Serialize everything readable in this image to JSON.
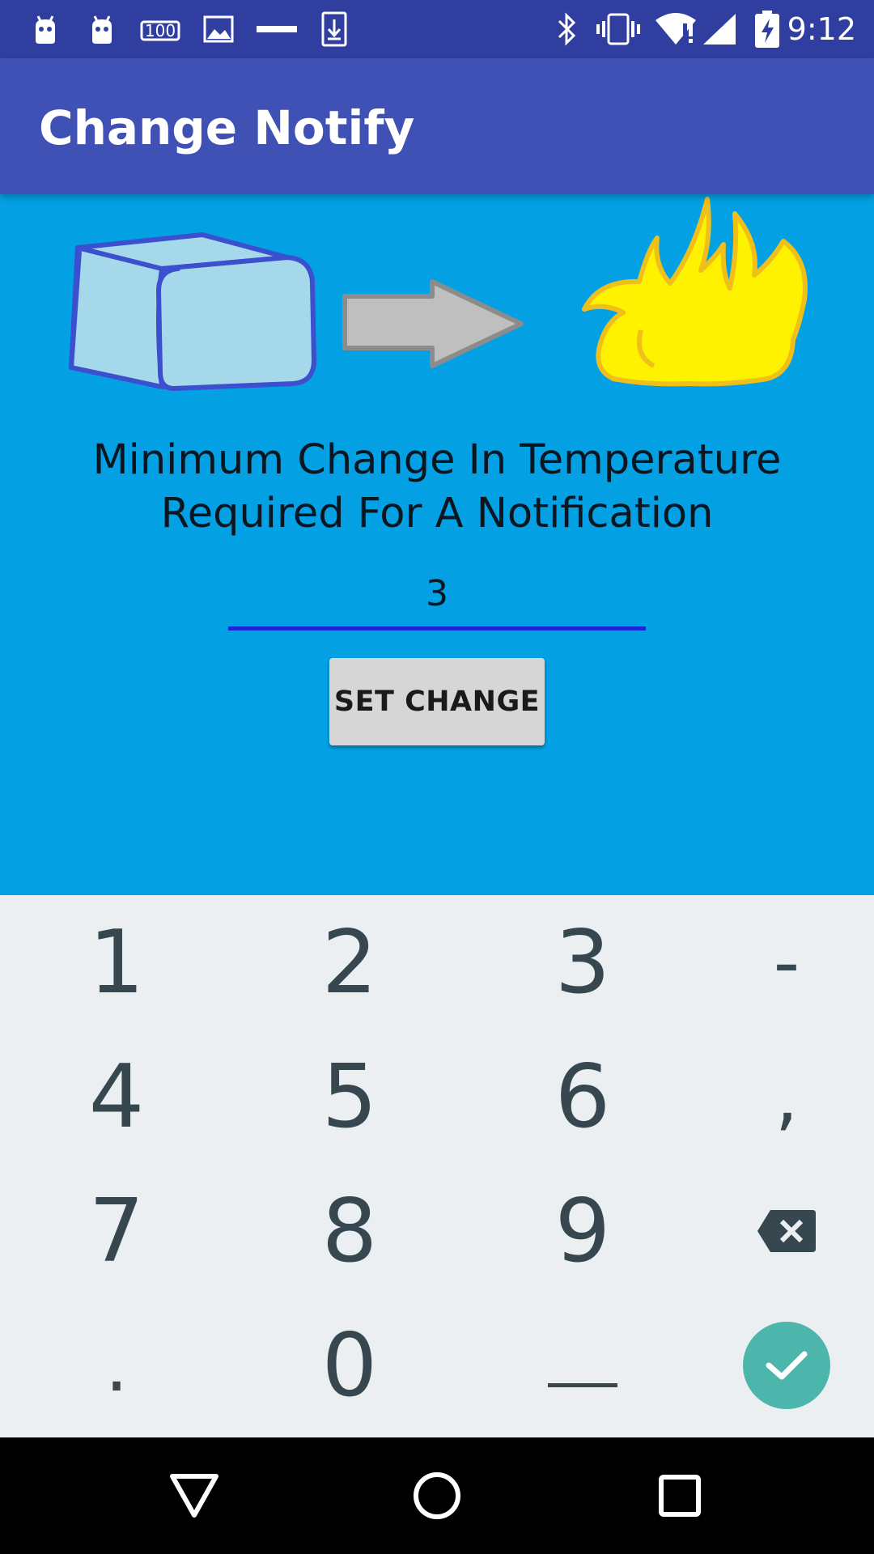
{
  "status_bar": {
    "time": "9:12",
    "left_icons": [
      "android-icon",
      "android-icon",
      "hundred-icon",
      "image-icon",
      "minus-icon",
      "download-icon"
    ],
    "right_icons": [
      "bluetooth-icon",
      "vibrate-icon",
      "wifi-icon",
      "signal-icon",
      "battery-charging-icon"
    ]
  },
  "app_bar": {
    "title": "Change Notify"
  },
  "main": {
    "prompt_line1": "Minimum Change In Temperature",
    "prompt_line2": "Required For A Notification",
    "change_value": "3",
    "set_button_label": "SET CHANGE"
  },
  "keyboard": {
    "rows": [
      [
        "1",
        "2",
        "3",
        "-"
      ],
      [
        "4",
        "5",
        "6",
        ","
      ],
      [
        "7",
        "8",
        "9",
        "backspace"
      ],
      [
        ".",
        "0",
        "space",
        "done"
      ]
    ]
  },
  "colors": {
    "status_bar": "#303f9f",
    "app_bar": "#3f51b5",
    "content_bg": "#03a1e3",
    "keyboard_bg": "#eceff1",
    "key_text": "#37474f",
    "done_key": "#4db6ac",
    "input_underline": "#1b27d6"
  }
}
